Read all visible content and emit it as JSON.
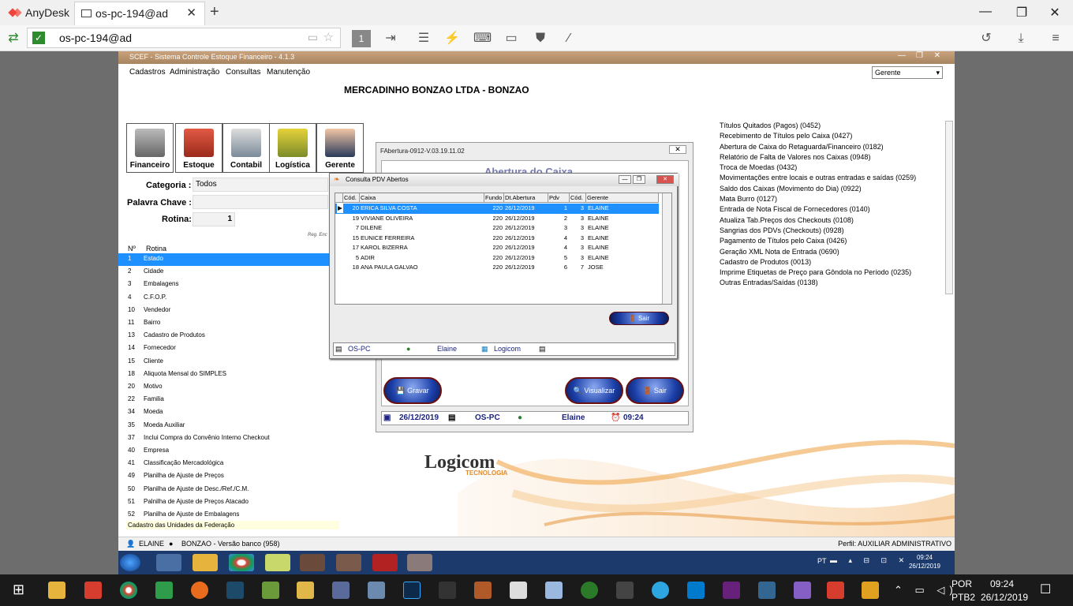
{
  "anydesk": {
    "app_name": "AnyDesk",
    "tab_title": "os-pc-194@ad",
    "address": "os-pc-194@ad",
    "monitor_number": "1",
    "window_controls": [
      "minimize-icon",
      "restore-icon",
      "close-icon"
    ],
    "toolbar_icons": [
      "chat-icon",
      "actions-icon",
      "keyboard-icon",
      "display-icon",
      "privacy-icon",
      "whiteboard-icon",
      "history-icon",
      "download-icon",
      "menu-icon"
    ]
  },
  "scef": {
    "window_title": "SCEF - Sistema Controle Estoque Financeiro - 4.1.3",
    "menu": [
      "Cadastros",
      "Administração",
      "Consultas",
      "Manutenção"
    ],
    "profile_select": "Gerente",
    "company": "MERCADINHO BONZAO LTDA - BONZAO",
    "modules": [
      "Financeiro",
      "Estoque",
      "Contabil",
      "Logística",
      "Gerente"
    ],
    "categoria_label": "Categoria :",
    "categoria_value": "Todos",
    "palavra_label": "Palavra Chave :",
    "rotina_label": "Rotina:",
    "rotina_value": "1",
    "reg_label": "Reg. Enc",
    "col_no": "Nº",
    "col_rotina": "Rotina",
    "rotinas": [
      {
        "n": "1",
        "d": "Estado"
      },
      {
        "n": "2",
        "d": "Cidade"
      },
      {
        "n": "3",
        "d": "Embalagens"
      },
      {
        "n": "4",
        "d": "C.F.O.P."
      },
      {
        "n": "10",
        "d": "Vendedor"
      },
      {
        "n": "11",
        "d": "Bairro"
      },
      {
        "n": "13",
        "d": "Cadastro de Produtos"
      },
      {
        "n": "14",
        "d": "Fornecedor"
      },
      {
        "n": "15",
        "d": "Cliente"
      },
      {
        "n": "18",
        "d": "Aliquota Mensal do SIMPLES"
      },
      {
        "n": "20",
        "d": "Motivo"
      },
      {
        "n": "22",
        "d": "Familia"
      },
      {
        "n": "34",
        "d": "Moeda"
      },
      {
        "n": "35",
        "d": "Moeda Auxiliar"
      },
      {
        "n": "37",
        "d": "Inclui Compra do Convênio Interno Checkout"
      },
      {
        "n": "40",
        "d": "Empresa"
      },
      {
        "n": "41",
        "d": "Classificação Mercadológica"
      },
      {
        "n": "49",
        "d": "Planilha de Ajuste de Preços"
      },
      {
        "n": "50",
        "d": "Planilha de Ajuste de Desc./Ref./C.M."
      },
      {
        "n": "51",
        "d": "Palnilha de Ajuste de Preços Atacado"
      },
      {
        "n": "52",
        "d": "Planilha de Ajuste de Embalagens"
      }
    ],
    "rotina_hint": "Cadastro das Unidades da Federação",
    "recent": [
      "Títulos Quitados (Pagos) (0452)",
      "Recebimento de Títulos pelo Caixa (0427)",
      "Abertura de Caixa do Retaguarda/Financeiro (0182)",
      "Relatório de Falta de Valores nos Caixas (0948)",
      "Troca de Moedas (0432)",
      "Movimentações entre locais e outras entradas e saídas (0259)",
      "Saldo dos Caixas (Movimento do Dia) (0922)",
      "Mata Burro (0127)",
      "Entrada de Nota Fiscal de Fornecedores (0140)",
      "Atualiza Tab.Preços dos Checkouts (0108)",
      "Sangrias dos PDVs (Checkouts) (0928)",
      "Pagamento de Títulos pelo Caixa (0426)",
      "Geração XML Nota de Entrada (0690)",
      "Cadastro de Produtos (0013)",
      "Imprime Etiquetas de Preço para Gôndola no Período (0235)",
      "Outras Entradas/Saídas (0138)"
    ],
    "status_user": "ELAINE",
    "status_db": "BONZAO - Versão banco (958)",
    "status_profile": "Perfil: AUXILIAR ADMINISTRATIVO",
    "logo_text": "Logicom",
    "logo_sub": "TECNOLOGIA"
  },
  "abertura": {
    "title": "FAbertura-0912-V.03.19.11.02",
    "header": "Abertura do Caixa",
    "gravar": "Gravar",
    "visualizar": "Visualizar",
    "sair": "Sair",
    "date": "26/12/2019",
    "pc": "OS-PC",
    "user": "Elaine",
    "time": "09:24"
  },
  "pdv": {
    "title": "Consulta PDV Abertos",
    "columns": [
      "Cód.",
      "Caixa",
      "Fundo",
      "Dt.Abertura",
      "Pdv",
      "Cód.",
      "Gerente"
    ],
    "rows": [
      [
        "20",
        "ERICA SILVA COSTA",
        "220",
        "26/12/2019",
        "1",
        "3",
        "ELAINE"
      ],
      [
        "19",
        "VIVIANE OLIVEIRA",
        "220",
        "26/12/2019",
        "2",
        "3",
        "ELAINE"
      ],
      [
        "7",
        "DILENE",
        "220",
        "26/12/2019",
        "3",
        "3",
        "ELAINE"
      ],
      [
        "15",
        "EUNICE FERREIRA",
        "220",
        "26/12/2019",
        "4",
        "3",
        "ELAINE"
      ],
      [
        "17",
        "KAROL BIZERRA",
        "220",
        "26/12/2019",
        "4",
        "3",
        "ELAINE"
      ],
      [
        "5",
        "ADIR",
        "220",
        "26/12/2019",
        "5",
        "3",
        "ELAINE"
      ],
      [
        "18",
        "ANA PAULA GALVAO",
        "220",
        "26/12/2019",
        "6",
        "7",
        "JOSE"
      ]
    ],
    "sair": "Sair",
    "status_pc": "OS-PC",
    "status_user": "Elaine",
    "status_company": "Logicom"
  },
  "remote_taskbar": {
    "lang": "PT",
    "time": "09:24",
    "date": "26/12/2019"
  },
  "local_taskbar": {
    "lang1": "POR",
    "lang2": "PTB2",
    "time": "09:24",
    "date": "26/12/2019"
  }
}
